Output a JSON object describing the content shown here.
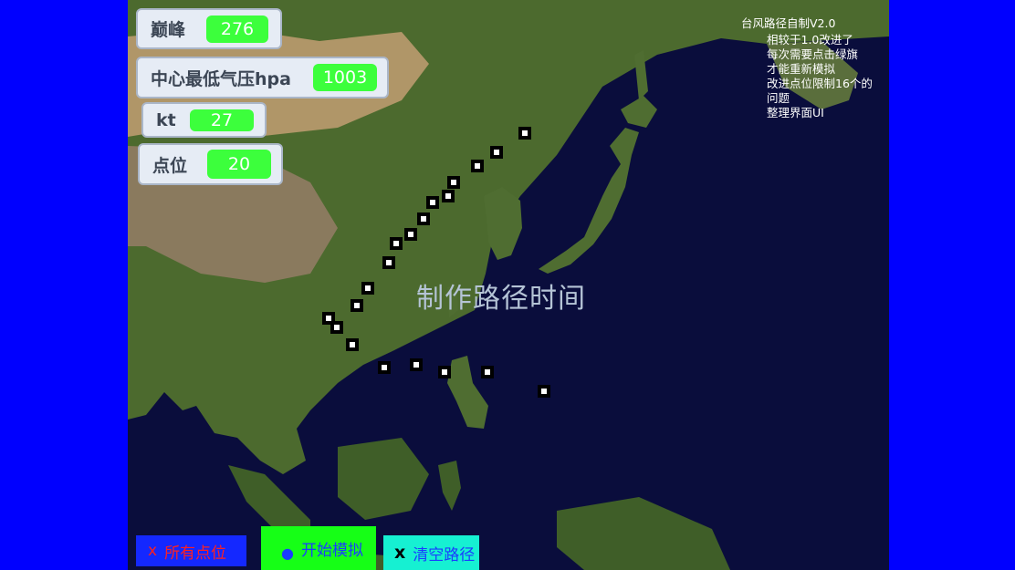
{
  "stats": {
    "peak": {
      "label": "巅峰",
      "value": "276"
    },
    "pressure": {
      "label": "中心最低气压hpa",
      "value": "1003"
    },
    "kt": {
      "label": "kt",
      "value": "27"
    },
    "points": {
      "label": "点位",
      "value": "20"
    }
  },
  "center_title": "制作路径时间",
  "version_title": "台风路径自制V2.0",
  "notes": [
    "相较于1.0改进了",
    "每次需要点击绿旗",
    "才能重新模拟",
    "改进点位限制16个的",
    "问题",
    "整理界面UI"
  ],
  "buttons": {
    "all_points": {
      "icon": "x-icon",
      "glyph": "x",
      "label": "所有点位"
    },
    "start": {
      "icon": "blue-dot-icon",
      "glyph": "●",
      "label": "开始模拟"
    },
    "clear": {
      "icon": "x-icon",
      "glyph": "x",
      "label": "清空路径"
    }
  },
  "colors": {
    "background": "#0000ff",
    "ocean": "#0a0d3c",
    "value_badge": "#3cff3c",
    "start_button": "#16ff16",
    "clear_button": "#16f0d2",
    "all_button": "#1428ff"
  }
}
